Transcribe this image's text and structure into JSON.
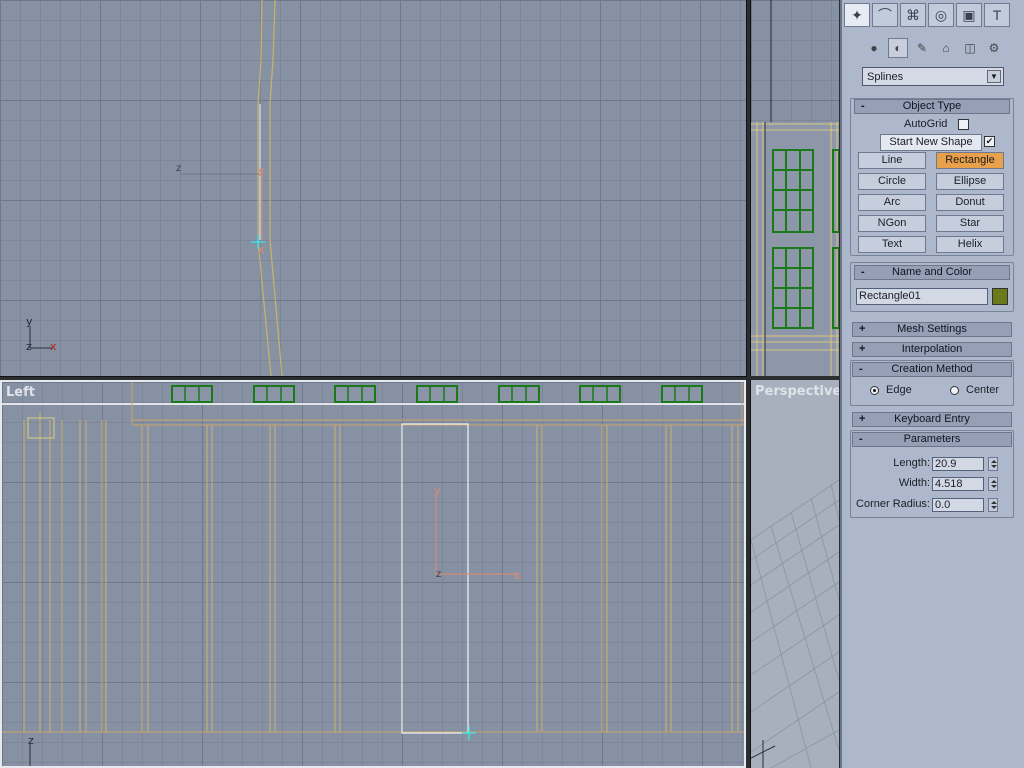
{
  "viewports": {
    "left_label": "Left",
    "perspective_label": "Perspective"
  },
  "panel": {
    "tabs": [
      {
        "icon": "create-tab-icon",
        "glyph": "✦"
      },
      {
        "icon": "modify-tab-icon",
        "glyph": "⌒"
      },
      {
        "icon": "hierarchy-tab-icon",
        "glyph": "⌘"
      },
      {
        "icon": "motion-tab-icon",
        "glyph": "◎"
      },
      {
        "icon": "display-tab-icon",
        "glyph": "▣"
      },
      {
        "icon": "utilities-tab-icon",
        "glyph": "T"
      }
    ],
    "subtabs": [
      {
        "icon": "geometry-icon",
        "glyph": "●"
      },
      {
        "icon": "shapes-icon",
        "glyph": "◐"
      },
      {
        "icon": "lights-icon",
        "glyph": "✎"
      },
      {
        "icon": "cameras-icon",
        "glyph": "⌂"
      },
      {
        "icon": "helpers-icon",
        "glyph": "◫"
      },
      {
        "icon": "systems-icon",
        "glyph": "⚙"
      }
    ],
    "category_dropdown": "Splines",
    "object_type": {
      "title": "Object Type",
      "autogrid": "AutoGrid",
      "start_new_shape": "Start New Shape",
      "buttons": [
        "Line",
        "Rectangle",
        "Circle",
        "Ellipse",
        "Arc",
        "Donut",
        "NGon",
        "Star",
        "Text",
        "Helix"
      ],
      "active_button": "Rectangle"
    },
    "name_and_color": {
      "title": "Name and Color",
      "name": "Rectangle01",
      "color": "#6b7a1a"
    },
    "mesh_settings": "Mesh Settings",
    "interpolation": "Interpolation",
    "creation_method": {
      "title": "Creation Method",
      "edge": "Edge",
      "center": "Center"
    },
    "keyboard_entry": "Keyboard Entry",
    "parameters": {
      "title": "Parameters",
      "length_label": "Length:",
      "length": "20.9",
      "width_label": "Width:",
      "width": "4.518",
      "corner_radius_label": "Corner Radius:",
      "corner_radius": "0.0"
    }
  },
  "colors": {
    "accent": "#e8a04a",
    "viewport": "#8791a4",
    "panel": "#aeb8cc"
  }
}
